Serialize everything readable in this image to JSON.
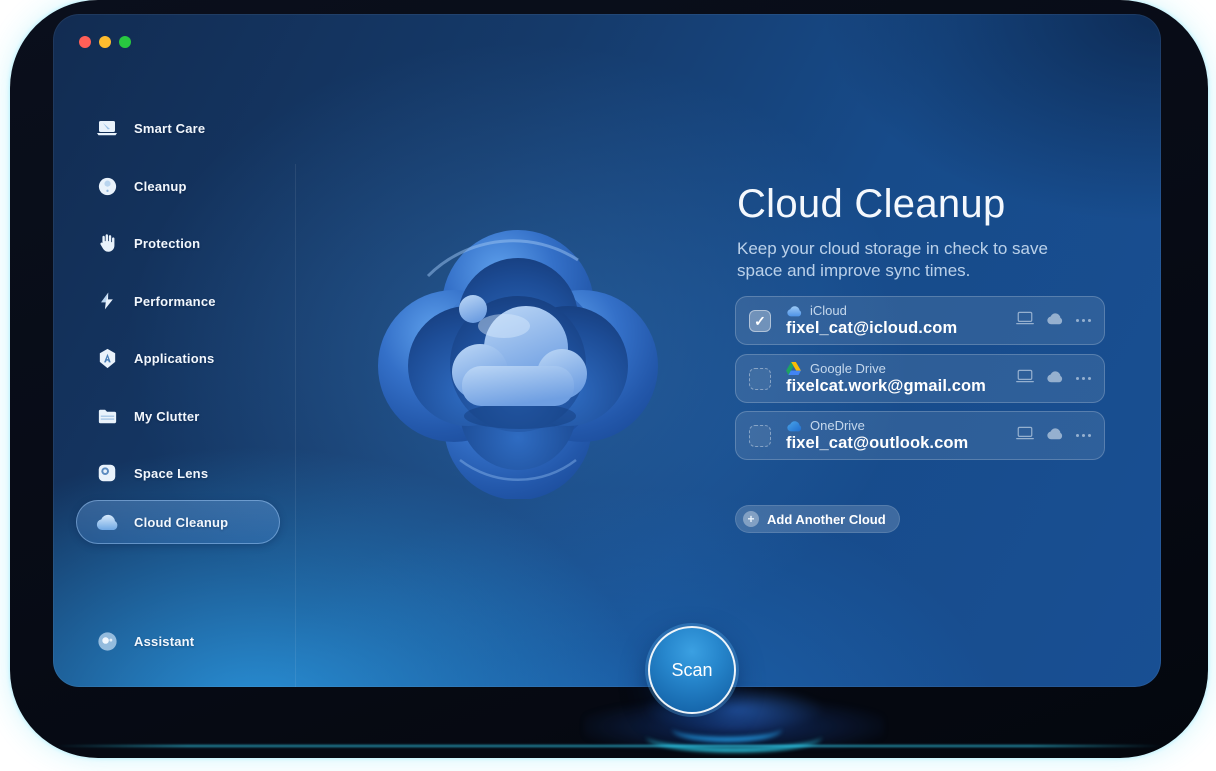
{
  "window": {
    "traffic_lights": [
      "close",
      "minimize",
      "zoom"
    ]
  },
  "sidebar": {
    "items": [
      {
        "label": "Smart Care",
        "icon": "laptop-sparkle-icon"
      },
      {
        "label": "Cleanup",
        "icon": "orb-icon"
      },
      {
        "label": "Protection",
        "icon": "hand-icon"
      },
      {
        "label": "Performance",
        "icon": "lightning-icon"
      },
      {
        "label": "Applications",
        "icon": "app-badge-icon"
      },
      {
        "label": "My Clutter",
        "icon": "folder-icon"
      },
      {
        "label": "Space Lens",
        "icon": "lens-icon"
      },
      {
        "label": "Cloud Cleanup",
        "icon": "cloud-icon",
        "active": true
      },
      {
        "label": "Assistant",
        "icon": "assistant-orb-icon"
      }
    ],
    "active_item": "Cloud Cleanup"
  },
  "main": {
    "title": "Cloud Cleanup",
    "subtitle": "Keep your cloud storage in check to save space and improve sync times.",
    "accounts": [
      {
        "provider": "iCloud",
        "email": "fixel_cat@icloud.com",
        "checked": true,
        "icon": "icloud-cloud-icon"
      },
      {
        "provider": "Google Drive",
        "email": "fixelcat.work@gmail.com",
        "checked": false,
        "icon": "google-drive-icon"
      },
      {
        "provider": "OneDrive",
        "email": "fixel_cat@outlook.com",
        "checked": false,
        "icon": "onedrive-cloud-icon"
      }
    ],
    "add_button_label": "Add Another Cloud",
    "scan_button_label": "Scan",
    "check_glyph": "✓"
  },
  "colors": {
    "accent_cyan": "#35ddff",
    "window_bright_blue": "#1e7cc8",
    "window_dark_navy": "#122c52",
    "traffic_red": "#ff5f57",
    "traffic_yellow": "#febc2e",
    "traffic_green": "#28c840"
  }
}
